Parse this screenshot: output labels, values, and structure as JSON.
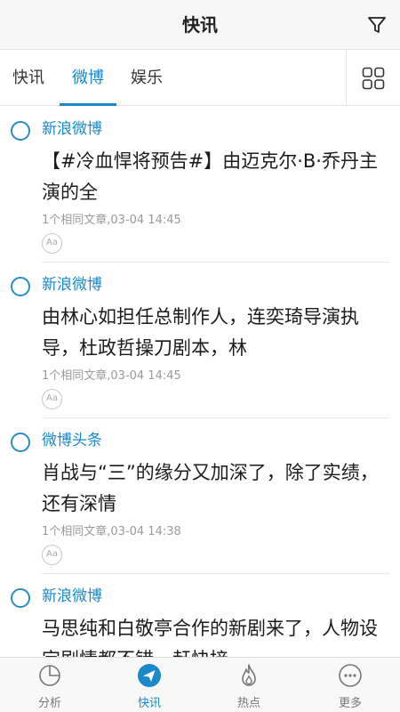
{
  "header": {
    "title": "快讯",
    "filter_icon": "filter-icon"
  },
  "tabs": [
    {
      "label": "快讯",
      "active": false
    },
    {
      "label": "微博",
      "active": true
    },
    {
      "label": "娱乐",
      "active": false
    }
  ],
  "grid_icon": "grid-icon",
  "feed": [
    {
      "source": "新浪微博",
      "headline": "【#冷血悍将预告#】由迈克尔·B·乔丹主演的全",
      "meta": "1个相同文章,03-04 14:45",
      "font_icon": "Aa"
    },
    {
      "source": "新浪微博",
      "headline": "由林心如担任总制作人，连奕琦导演执导，杜政哲操刀剧本，林",
      "meta": "1个相同文章,03-04 14:45",
      "font_icon": "Aa"
    },
    {
      "source": "微博头条",
      "headline": "肖战与“三”的缘分又加深了，除了实绩，还有深情",
      "meta": "1个相同文章,03-04 14:38",
      "font_icon": "Aa"
    },
    {
      "source": "新浪微博",
      "headline": "马思纯和白敬亭合作的新剧来了，人物设定剧情都不错，赶快接",
      "meta": "",
      "font_icon": "Aa"
    }
  ],
  "bottom_nav": [
    {
      "label": "分析",
      "icon": "pie-chart-icon",
      "active": false
    },
    {
      "label": "快讯",
      "icon": "send-icon",
      "active": true
    },
    {
      "label": "热点",
      "icon": "flame-icon",
      "active": false
    },
    {
      "label": "更多",
      "icon": "more-icon",
      "active": false
    }
  ],
  "colors": {
    "accent": "#1a88c9",
    "text": "#1b1b1b",
    "muted": "#9a9a9a"
  }
}
